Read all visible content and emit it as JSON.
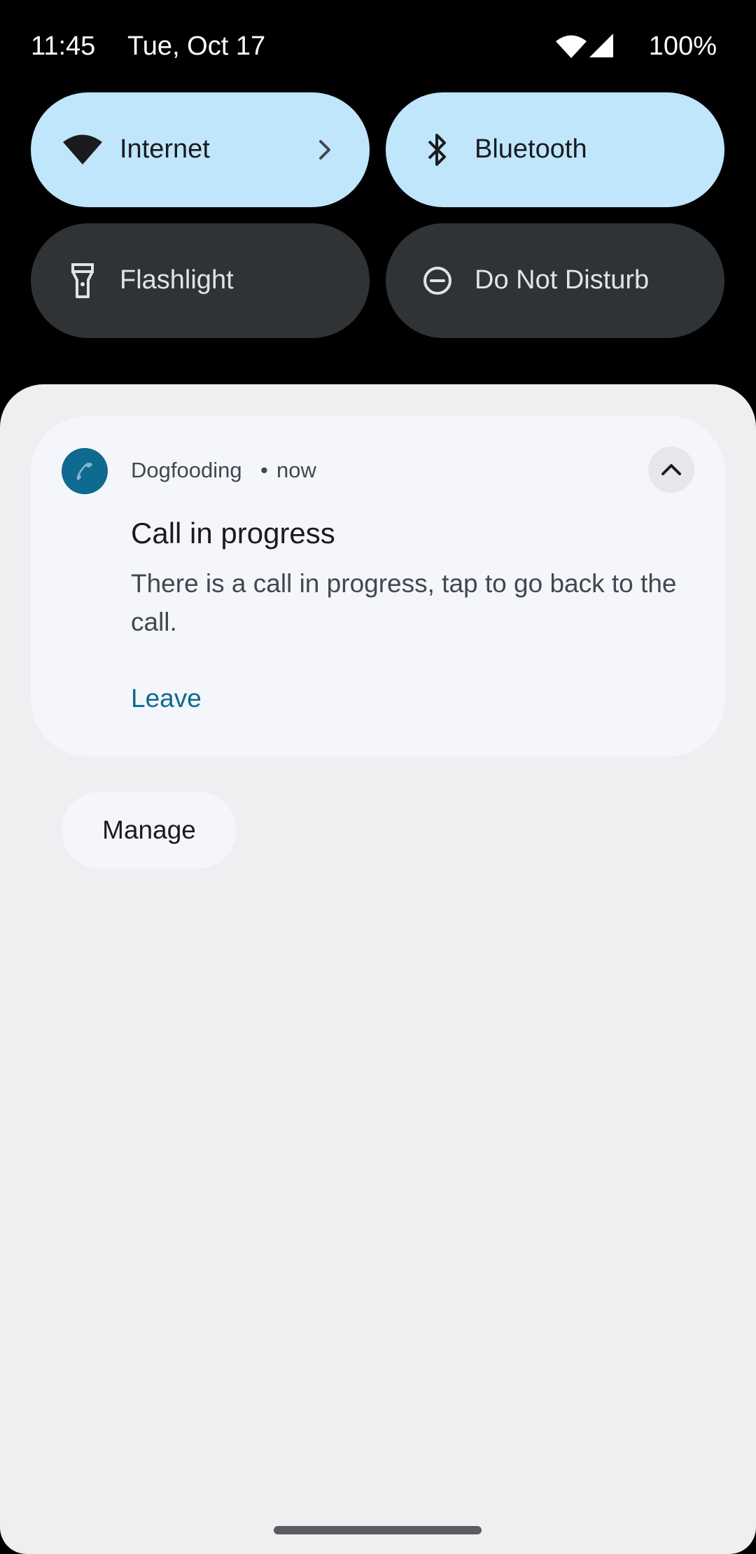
{
  "status_bar": {
    "time": "11:45",
    "date": "Tue, Oct 17",
    "battery": "100%",
    "wifi_icon": "wifi-icon",
    "signal_icon": "cell-signal-icon"
  },
  "quick_settings": {
    "tiles": [
      {
        "label": "Internet",
        "icon": "wifi-icon",
        "state": "on",
        "has_chevron": true
      },
      {
        "label": "Bluetooth",
        "icon": "bluetooth-icon",
        "state": "on"
      },
      {
        "label": "Flashlight",
        "icon": "flashlight-icon",
        "state": "off"
      },
      {
        "label": "Do Not Disturb",
        "icon": "do-not-disturb-icon",
        "state": "off"
      }
    ]
  },
  "notification": {
    "app_name": "Dogfooding",
    "separator": "•",
    "time": "now",
    "app_icon": "phone-call-icon",
    "title": "Call in progress",
    "body": "There is a call in progress, tap to go back to the call.",
    "action": "Leave"
  },
  "manage_button": {
    "label": "Manage"
  },
  "colors": {
    "tile_on": "#c0e6fb",
    "tile_off": "#303336",
    "accent": "#0e6a8e",
    "shade_bg": "#efeff1"
  }
}
